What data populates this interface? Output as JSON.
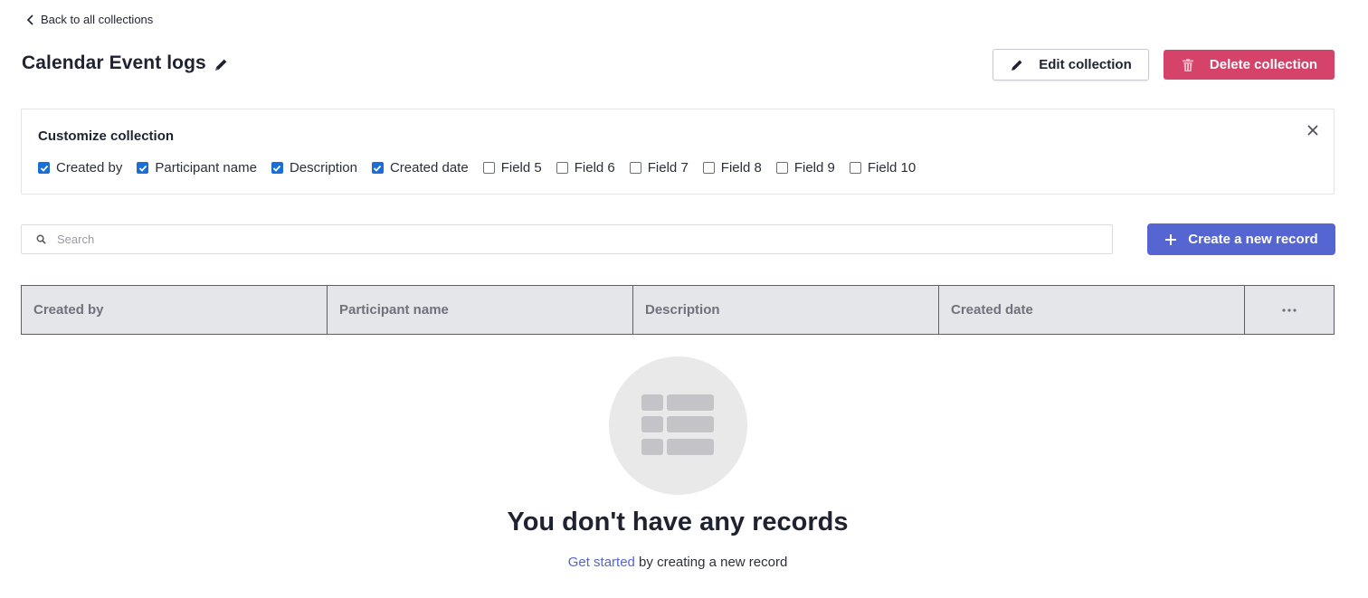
{
  "nav": {
    "back_label": "Back to all collections"
  },
  "page": {
    "title": "Calendar Event logs"
  },
  "actions": {
    "edit_label": "Edit collection",
    "delete_label": "Delete collection",
    "create_label": "Create a new record"
  },
  "customize": {
    "title": "Customize collection",
    "fields": [
      {
        "label": "Created by",
        "checked": true
      },
      {
        "label": "Participant name",
        "checked": true
      },
      {
        "label": "Description",
        "checked": true
      },
      {
        "label": "Created date",
        "checked": true
      },
      {
        "label": "Field 5",
        "checked": false
      },
      {
        "label": "Field 6",
        "checked": false
      },
      {
        "label": "Field 7",
        "checked": false
      },
      {
        "label": "Field 8",
        "checked": false
      },
      {
        "label": "Field 9",
        "checked": false
      },
      {
        "label": "Field 10",
        "checked": false
      }
    ]
  },
  "search": {
    "placeholder": "Search",
    "value": ""
  },
  "table": {
    "columns": [
      "Created by",
      "Participant name",
      "Description",
      "Created date"
    ]
  },
  "empty_state": {
    "title": "You don't have any records",
    "link_label": "Get started",
    "suffix": " by creating a new record"
  },
  "colors": {
    "primary": "#5565d2",
    "danger": "#d5436a",
    "checkbox": "#1a6fd6",
    "header_bg": "#e4e6ea"
  },
  "icons": {
    "back": "chevron-left-icon",
    "edit": "pencil-icon",
    "delete": "trash-icon",
    "close": "close-icon",
    "search": "search-icon",
    "create": "plus-icon",
    "more": "more-horizontal-icon",
    "empty": "table-icon"
  }
}
